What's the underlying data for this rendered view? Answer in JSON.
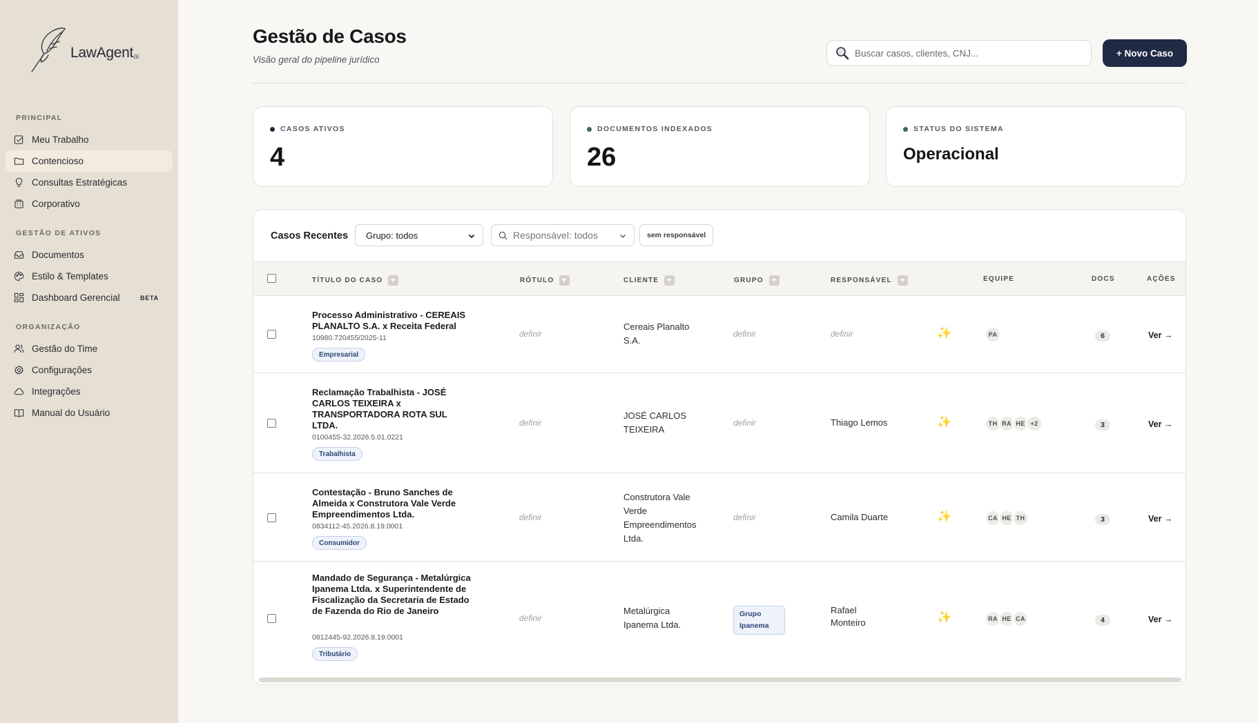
{
  "app": {
    "logo_text": "LawAgent",
    "logo_suffix": "ai"
  },
  "sidebar": {
    "sections": [
      {
        "heading": "PRINCIPAL",
        "items": [
          {
            "label": "Meu Trabalho",
            "icon": "checkbox-edit-icon"
          },
          {
            "label": "Contencioso",
            "icon": "folder-icon",
            "active": true
          },
          {
            "label": "Consultas Estratégicas",
            "icon": "lightbulb-icon"
          },
          {
            "label": "Corporativo",
            "icon": "building-icon"
          }
        ]
      },
      {
        "heading": "GESTÃO DE ATIVOS",
        "items": [
          {
            "label": "Documentos",
            "icon": "inbox-icon"
          },
          {
            "label": "Estilo & Templates",
            "icon": "palette-icon"
          },
          {
            "label": "Dashboard Gerencial",
            "icon": "dashboard-icon",
            "badge": "BETA"
          }
        ]
      },
      {
        "heading": "ORGANIZAÇÃO",
        "items": [
          {
            "label": "Gestão do Time",
            "icon": "users-icon"
          },
          {
            "label": "Configurações",
            "icon": "gear-icon"
          },
          {
            "label": "Integrações",
            "icon": "cloud-icon"
          },
          {
            "label": "Manual do Usuário",
            "icon": "book-icon"
          }
        ]
      }
    ]
  },
  "header": {
    "title": "Gestão de Casos",
    "subtitle": "Visão geral do pipeline jurídico",
    "search_placeholder": "Buscar casos, clientes, CNJ...",
    "new_case_label": "+ Novo Caso"
  },
  "stats": [
    {
      "label": "CASOS ATIVOS",
      "value": "4",
      "dot_color": "#1f2a44"
    },
    {
      "label": "DOCUMENTOS INDEXADOS",
      "value": "26",
      "dot_color": "#3d6b4e"
    },
    {
      "label": "STATUS DO SISTEMA",
      "value": "Operacional",
      "dot_color": "#3d6b4e"
    }
  ],
  "table": {
    "title": "Casos Recentes",
    "group_filter": "Grupo: todos",
    "owner_filter_placeholder": "Responsável: todos",
    "no_owner_label": "sem responsável",
    "columns": {
      "title": "TÍTULO DO CASO",
      "label": "RÓTULO",
      "client": "CLIENTE",
      "group": "GRUPO",
      "owner": "RESPONSÁVEL",
      "team": "EQUIPE",
      "docs": "DOCS",
      "actions": "AÇÕES"
    },
    "rows": [
      {
        "title": "Processo Administrativo - CEREAIS PLANALTO S.A. x Receita Federal",
        "cnj": "10980.720455/2025-11",
        "tag": "Empresarial",
        "label": "definir",
        "client": "Cereais Planalto S.A.",
        "group": "definir",
        "owner": "definir",
        "team": [
          "PA"
        ],
        "docs": "6",
        "action": "Ver →"
      },
      {
        "title": "Reclamação Trabalhista - JOSÉ CARLOS TEIXEIRA x TRANSPORTADORA ROTA SUL LTDA.",
        "cnj": "0100455-32.2026.5.01.0221",
        "tag": "Trabalhista",
        "label": "definir",
        "client": "JOSÉ CARLOS TEIXEIRA",
        "group": "definir",
        "owner": "Thiago Lemos",
        "team": [
          "TH",
          "RA",
          "HE",
          "+2"
        ],
        "docs": "3",
        "action": "Ver →"
      },
      {
        "title": "Contestação - Bruno Sanches de Almeida x Construtora Vale Verde Empreendimentos Ltda.",
        "cnj": "0834112-45.2026.8.19.0001",
        "tag": "Consumidor",
        "label": "definir",
        "client": "Construtora Vale Verde Empreendimentos Ltda.",
        "group": "definir",
        "owner": "Camila Duarte",
        "team": [
          "CA",
          "HE",
          "TH"
        ],
        "docs": "3",
        "action": "Ver →"
      },
      {
        "title": "Mandado de Segurança - Metalúrgica Ipanema Ltda. x Superintendente de Fiscalização da Secretaria de Estado de Fazenda do Rio de Janeiro",
        "cnj": "0812445-92.2026.8.19.0001",
        "tag": "Tributário",
        "label": "definir",
        "client": "Metalúrgica Ipanema Ltda.",
        "group": "Grupo Ipanema",
        "owner": "Rafael Monteiro",
        "team": [
          "RA",
          "HE",
          "CA"
        ],
        "docs": "4",
        "action": "Ver →"
      }
    ]
  }
}
